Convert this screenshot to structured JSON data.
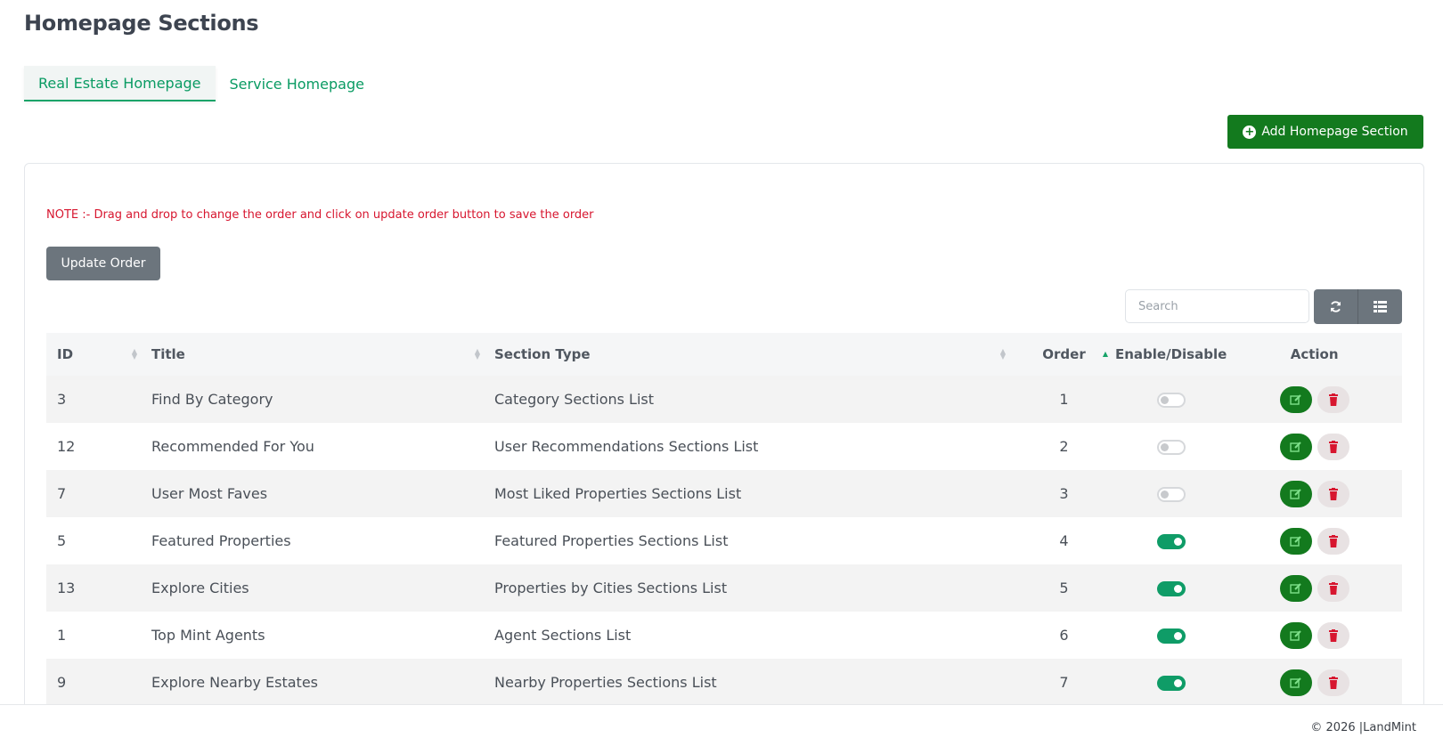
{
  "page": {
    "title": "Homepage Sections"
  },
  "tabs": [
    {
      "label": "Real Estate Homepage",
      "active": true
    },
    {
      "label": "Service Homepage",
      "active": false
    }
  ],
  "toolbar": {
    "add_label": "Add Homepage Section",
    "update_label": "Update Order"
  },
  "note": "NOTE :- Drag and drop to change the order and click on update order button to save the order",
  "search": {
    "placeholder": "Search"
  },
  "icons": {
    "add": "plus-circle-icon",
    "refresh": "refresh-icon",
    "columns": "columns-icon",
    "edit": "edit-icon",
    "delete": "trash-icon"
  },
  "colors": {
    "accent": "#137a1e",
    "tab_text": "#0a9b63",
    "note": "#d7162f",
    "toggle_on": "#0f9c67",
    "delete_icon": "#d7162f"
  },
  "table": {
    "columns": [
      "ID",
      "Title",
      "Section Type",
      "Order",
      "Enable/Disable",
      "Action"
    ],
    "rows": [
      {
        "id": "3",
        "title": "Find By Category",
        "type": "Category Sections List",
        "order": "1",
        "enabled": false
      },
      {
        "id": "12",
        "title": "Recommended For You",
        "type": "User Recommendations Sections List",
        "order": "2",
        "enabled": false
      },
      {
        "id": "7",
        "title": "User Most Faves",
        "type": "Most Liked Properties Sections List",
        "order": "3",
        "enabled": false
      },
      {
        "id": "5",
        "title": "Featured Properties",
        "type": "Featured Properties Sections List",
        "order": "4",
        "enabled": true
      },
      {
        "id": "13",
        "title": "Explore Cities",
        "type": "Properties by Cities Sections List",
        "order": "5",
        "enabled": true
      },
      {
        "id": "1",
        "title": "Top Mint Agents",
        "type": "Agent Sections List",
        "order": "6",
        "enabled": true
      },
      {
        "id": "9",
        "title": "Explore Nearby Estates",
        "type": "Nearby Properties Sections List",
        "order": "7",
        "enabled": true
      }
    ]
  },
  "footer": {
    "text": "© 2026 |LandMint"
  }
}
